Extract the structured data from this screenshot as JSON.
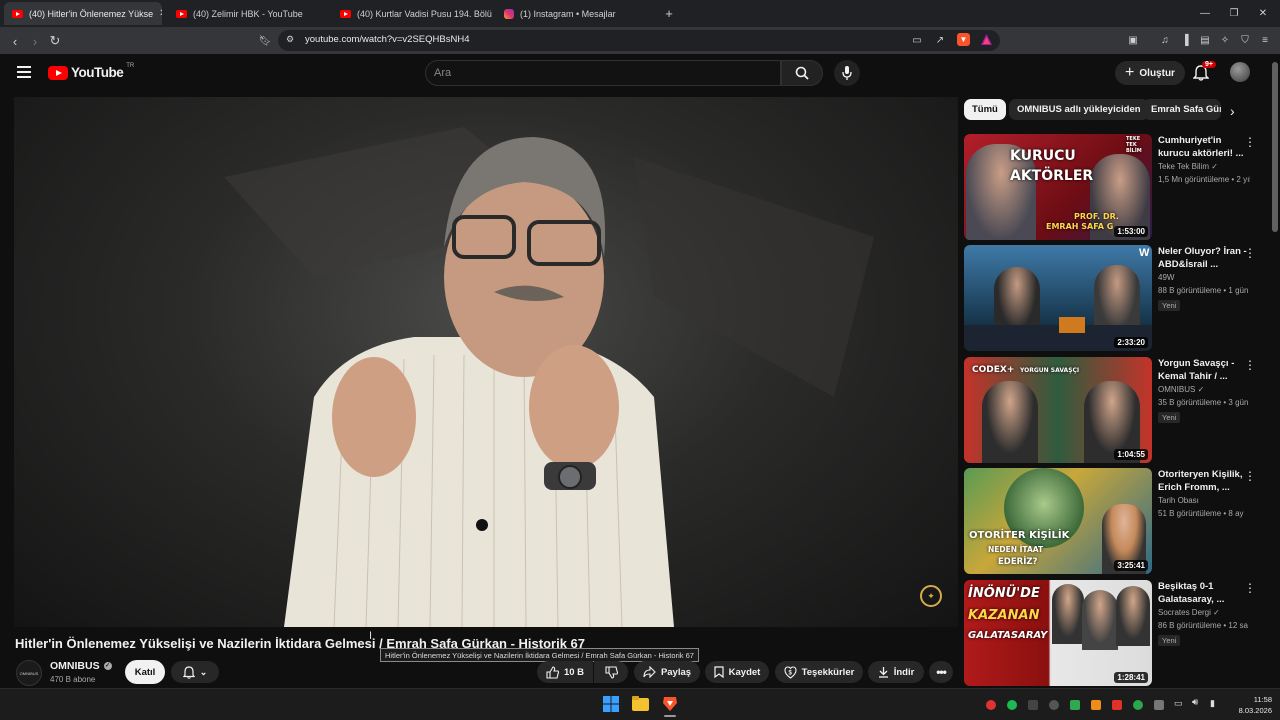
{
  "browser": {
    "tabs": [
      {
        "label": "(40) Hitler'in Önlenemez Yükse",
        "type": "youtube",
        "active": true
      },
      {
        "label": "(40) Zelimir HBK - YouTube",
        "type": "youtube",
        "active": false
      },
      {
        "label": "(40) Kurtlar Vadisi Pusu 194. Bölüm",
        "type": "youtube",
        "active": false
      },
      {
        "label": "(1) Instagram • Mesajlar",
        "type": "instagram",
        "active": false
      }
    ],
    "new_tab": "+",
    "url": "youtube.com/watch?v=v2SEQHBsNH4"
  },
  "youtube": {
    "logo_text": "YouTube",
    "region": "TR",
    "search_placeholder": "Ara",
    "create_label": "Oluştur",
    "notification_count": "9+"
  },
  "video": {
    "title": "Hitler'in Önlenemez Yükselişi ve Nazilerin İktidara Gelmesi / Emrah Safa Gürkan - Historik 67",
    "tooltip": "Hitler'in Önlenemez Yükselişi ve Nazilerin İktidara Gelmesi / Emrah Safa Gürkan - Historik 67",
    "channel": "OMNIBUS",
    "channel_avatar_text": "OMNIBUS",
    "subscribers": "470 B abone",
    "join_label": "Katıl",
    "likes": "10 B",
    "share_label": "Paylaş",
    "save_label": "Kaydet",
    "thanks_label": "Teşekkürler",
    "download_label": "İndir"
  },
  "chips": [
    "Tümü",
    "OMNIBUS adlı yükleyiciden",
    "Emrah Safa Gür"
  ],
  "recommendations": [
    {
      "title": "Cumhuriyet'in kurucu aktörleri! ...",
      "channel": "Teke Tek Bilim",
      "verified": true,
      "views": "1,5 Mn görüntüleme • 2 yıl",
      "duration": "1:53:00",
      "new": false,
      "thumb_text": [
        "KURUCU",
        "AKTÖRLER",
        "PROF. DR.",
        "EMRAH SAFA G",
        "TEKE TEK BİLİM"
      ]
    },
    {
      "title": "Neler Oluyor? İran - ABD&İsrail ...",
      "channel": "49W",
      "verified": false,
      "views": "88 B görüntüleme • 1 gün",
      "duration": "2:33:20",
      "new": true,
      "new_label": "Yeni",
      "thumb_text": []
    },
    {
      "title": "Yorgun Savaşçı - Kemal Tahir / ...",
      "channel": "OMNIBUS",
      "verified": true,
      "views": "35 B görüntüleme • 3 gün",
      "duration": "1:04:55",
      "new": true,
      "new_label": "Yeni",
      "thumb_text": [
        "CODEX+",
        "YORGUN SAVAŞÇI"
      ]
    },
    {
      "title": "Otoriteryen Kişilik, Erich Fromm, ...",
      "channel": "Tarih Obası",
      "verified": false,
      "views": "51 B görüntüleme • 8 ay",
      "duration": "3:25:41",
      "new": false,
      "thumb_text": [
        "OTORİTER KİŞİLİK",
        "NEDEN İTAAT",
        "EDERİZ?"
      ]
    },
    {
      "title": "Beşiktaş 0-1 Galatasaray, ...",
      "channel": "Socrates Dergi",
      "verified": true,
      "views": "86 B görüntüleme • 12 sa",
      "duration": "1:28:41",
      "new": true,
      "new_label": "Yeni",
      "thumb_text": [
        "İNÖNÜ'DE",
        "KAZANAN",
        "GALATASARAY"
      ]
    }
  ],
  "clock": {
    "time": "11:58",
    "date": "8.03.2026"
  },
  "colors": {
    "yt_red": "#ff0000",
    "bg": "#0f0f0f",
    "chip_bg": "#272727"
  }
}
